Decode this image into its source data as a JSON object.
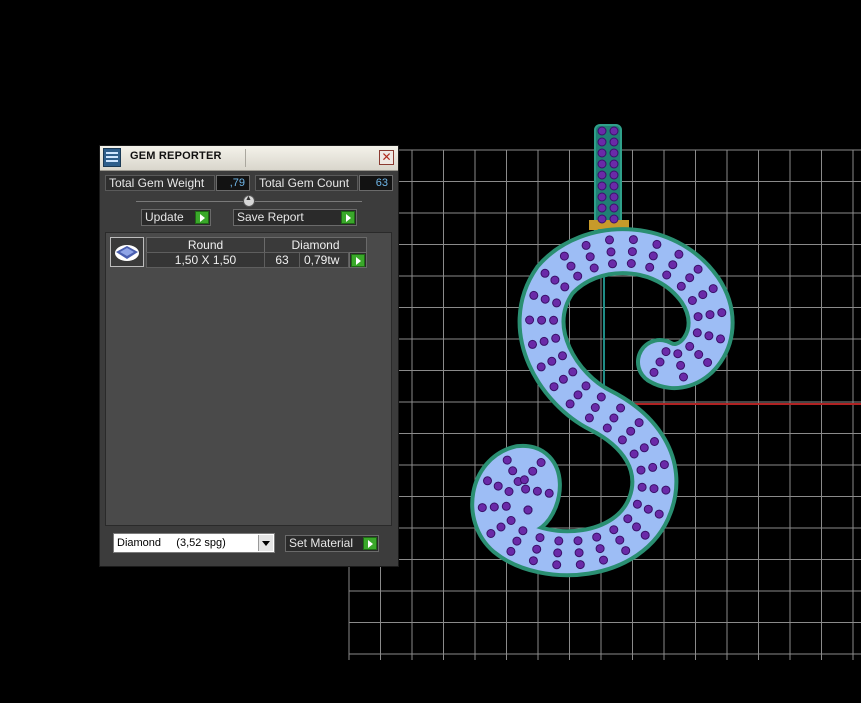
{
  "panel": {
    "title": "GEM REPORTER",
    "close_symbol": "✕",
    "icon_name": "gem-reporter-icon",
    "total_weight_label": "Total Gem Weight",
    "total_weight_value": ",79",
    "total_count_label": "Total Gem Count",
    "total_count_value": "63",
    "slider_level": 0.5,
    "update_label": "Update",
    "save_report_label": "Save Report",
    "table": {
      "headers": [
        "Round",
        "Diamond"
      ],
      "rows": [
        {
          "size": "1,50 X 1,50",
          "count": "63",
          "weight": "0,79tw"
        }
      ]
    },
    "material_select": {
      "value": "Diamond     (3,52 spg)"
    },
    "set_material_label": "Set Material"
  },
  "colors": {
    "accent_green": "#3aa82a",
    "value_text": "#6fb6e8",
    "grid": "#8a8a8a",
    "axis_red": "#b02222",
    "axis_teal": "#1f8c86",
    "metal": "#2a8f72",
    "pave": "#9dbdf5",
    "gem": "#6a2aa8"
  }
}
